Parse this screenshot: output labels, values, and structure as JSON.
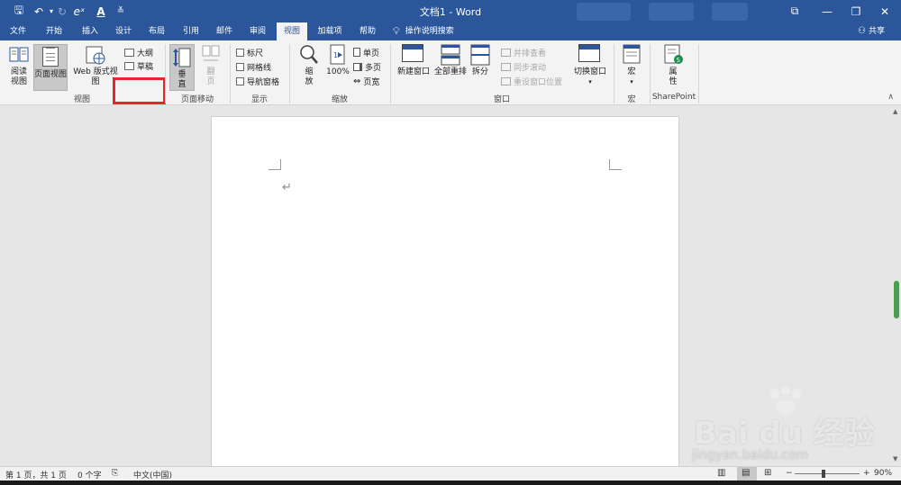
{
  "titlebar": {
    "title": "文档1  -  Word",
    "qa_save": "🖫",
    "qa_undo": "↶",
    "qa_redo": "↻",
    "qa_equation": "eˣ",
    "qa_font": "A",
    "qa_more": "≚",
    "win_ribbon": "⧉",
    "win_min": "—",
    "win_restore": "❐",
    "win_close": "✕"
  },
  "tabs": [
    "文件",
    "开始",
    "插入",
    "设计",
    "布局",
    "引用",
    "邮件",
    "审阅",
    "视图",
    "加载项",
    "帮助"
  ],
  "active_tab": "视图",
  "tellme": "操作说明搜索",
  "share": "共享",
  "ribbon": {
    "views": {
      "read_label": "阅读\n视图",
      "print_label": "页面视图",
      "web_label": "Web 版式视图",
      "outline_label": "大纲",
      "draft_label": "草稿",
      "group_label": "视图"
    },
    "page_move": {
      "vertical_label": "垂\n直",
      "side_label": "翻\n页",
      "group_label": "页面移动"
    },
    "show": {
      "ruler": "标尺",
      "gridlines": "网格线",
      "nav_pane": "导航窗格",
      "group_label": "显示"
    },
    "zoom": {
      "zoom_label": "缩\n放",
      "hundred_label": "100%",
      "one_page": "单页",
      "multi_page": "多页",
      "page_width": "页宽",
      "group_label": "缩放"
    },
    "window": {
      "new_window": "新建窗口",
      "arrange_all": "全部重排",
      "split": "拆分",
      "side_by_side": "并排查看",
      "sync_scroll": "同步滚动",
      "reset_pos": "重设窗口位置",
      "switch_window": "切换窗口",
      "group_label": "窗口"
    },
    "macros": {
      "macro_label": "宏",
      "group_label": "宏"
    },
    "sharepoint": {
      "props_label": "属\n性",
      "group_label": "SharePoint"
    }
  },
  "document": {
    "return_mark": "↵"
  },
  "statusbar": {
    "page": "第 1 页，共 1 页",
    "words": "0 个字",
    "language": "中文(中国)",
    "zoom_minus": "−",
    "zoom_plus": "+",
    "zoom": "90%",
    "zoom_level": 0.9
  },
  "watermark": {
    "logo": "Bai du 经验",
    "url": "jingyan.baidu.com"
  },
  "colors": {
    "accent": "#2b579a",
    "highlight": "#e8262a"
  }
}
